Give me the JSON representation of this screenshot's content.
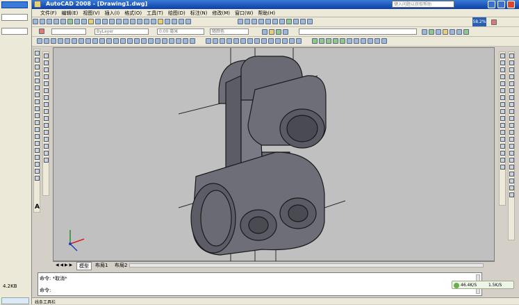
{
  "app": {
    "title": "AutoCAD 2008 - [Drawing1.dwg]",
    "search_placeholder": "键入问题以获取帮助"
  },
  "menu": [
    "文件(F)",
    "编辑(E)",
    "视图(V)",
    "插入(I)",
    "格式(O)",
    "工具(T)",
    "绘图(D)",
    "标注(N)",
    "修改(M)",
    "窗口(W)",
    "帮助(H)"
  ],
  "properties": {
    "color": "ByLayer",
    "lineweight": "0.00 毫米",
    "plotstyle": "随颜色"
  },
  "zoom_badge": "58.2%",
  "tabs": [
    "模型",
    "布局1",
    "布局2"
  ],
  "command": {
    "line1": "命令: *取消*",
    "line2": "命令:"
  },
  "status": {
    "left_text": "线条工具栏",
    "left_value": "4.2KB",
    "speed1": "46.4K/S",
    "speed2": "1.5K/S"
  },
  "left_panel_values": [
    "4.2KB"
  ],
  "colors": {
    "viewport": "#c0c0c0",
    "titlebar": "#0a3fa8",
    "model": "#6e6e78",
    "model_dark": "#4a4a52",
    "model_light": "#8a8a94"
  }
}
